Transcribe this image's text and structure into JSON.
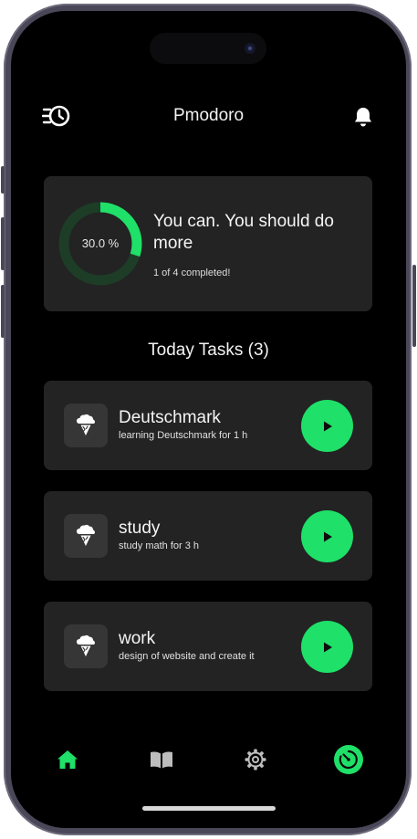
{
  "theme": {
    "accent": "#1fe068",
    "background": "#000000",
    "card": "#232323",
    "ring_track": "#1d3d27"
  },
  "header": {
    "title": "Pmodoro",
    "left_icon": "history-clock-icon",
    "right_icon": "bell-icon"
  },
  "progress": {
    "percent_label": "30.0 %",
    "percent_value": 30.0,
    "motto": "You can. You should do more",
    "completed_text": "1 of 4 completed!"
  },
  "tasks_section": {
    "title": "Today Tasks (3)"
  },
  "tasks": [
    {
      "name": "Deutschmark",
      "description": "learning Deutschmark for 1 h",
      "icon": "ice-cream-icon"
    },
    {
      "name": "study",
      "description": "study math for 3 h",
      "icon": "ice-cream-icon"
    },
    {
      "name": "work",
      "description": "design of website and create it",
      "icon": "ice-cream-icon"
    }
  ],
  "navbar": {
    "items": [
      {
        "icon": "home-icon",
        "active": true
      },
      {
        "icon": "book-icon",
        "active": false
      },
      {
        "icon": "gear-icon",
        "active": false
      },
      {
        "icon": "timer-icon",
        "active": false
      }
    ]
  }
}
